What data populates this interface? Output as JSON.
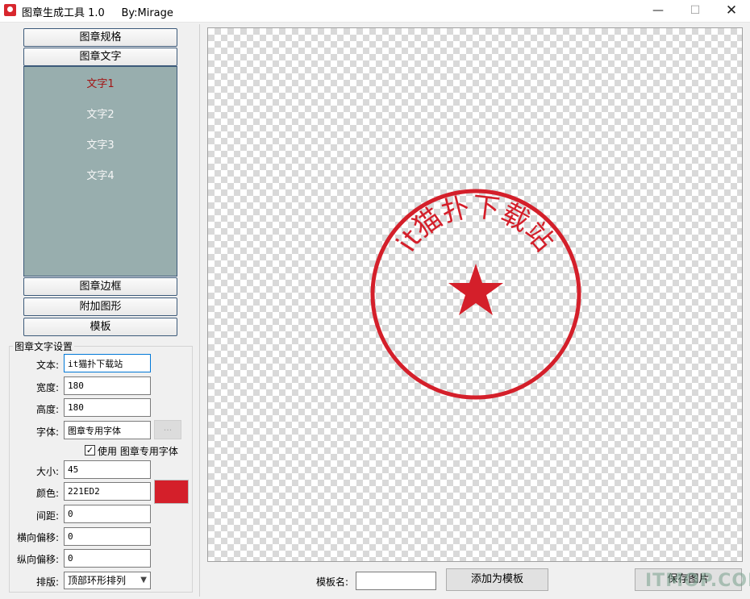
{
  "window": {
    "title": "图章生成工具 1.0     By:Mirage",
    "minimize_glyph": "—",
    "maximize_glyph": "☐",
    "close_glyph": "✕"
  },
  "nav": {
    "spec": "图章规格",
    "text": "图章文字",
    "text_items": [
      "文字1",
      "文字2",
      "文字3",
      "文字4"
    ],
    "border": "图章边框",
    "shape": "附加图形",
    "template": "模板"
  },
  "settings": {
    "group_title": "图章文字设置",
    "text_label": "文本:",
    "text_value": "it猫扑下载站",
    "width_label": "宽度:",
    "width_value": "180",
    "height_label": "高度:",
    "height_value": "180",
    "font_label": "字体:",
    "font_value": "图章专用字体",
    "browse_label": "...",
    "use_checked": "✓",
    "use_label": "使用 图章专用字体",
    "size_label": "大小:",
    "size_value": "45",
    "color_label": "颜色:",
    "color_value": "221ED2",
    "spacing_label": "间距:",
    "spacing_value": "0",
    "hoffset_label": "横向偏移:",
    "hoffset_value": "0",
    "voffset_label": "纵向偏移:",
    "voffset_value": "0",
    "layout_label": "排版:",
    "layout_value": "顶部环形排列"
  },
  "stamp": {
    "text": "it猫扑下载站",
    "color": "#d41f2a"
  },
  "bottom": {
    "template_name_label": "模板名:",
    "template_name_value": "",
    "add_template": "添加为模板",
    "save_image": "保存图片"
  },
  "watermark": "ITMOP.COM",
  "colors": {
    "swatch": "#d41f2a",
    "list_bg": "#98aeae",
    "active_item": "#a31515"
  }
}
